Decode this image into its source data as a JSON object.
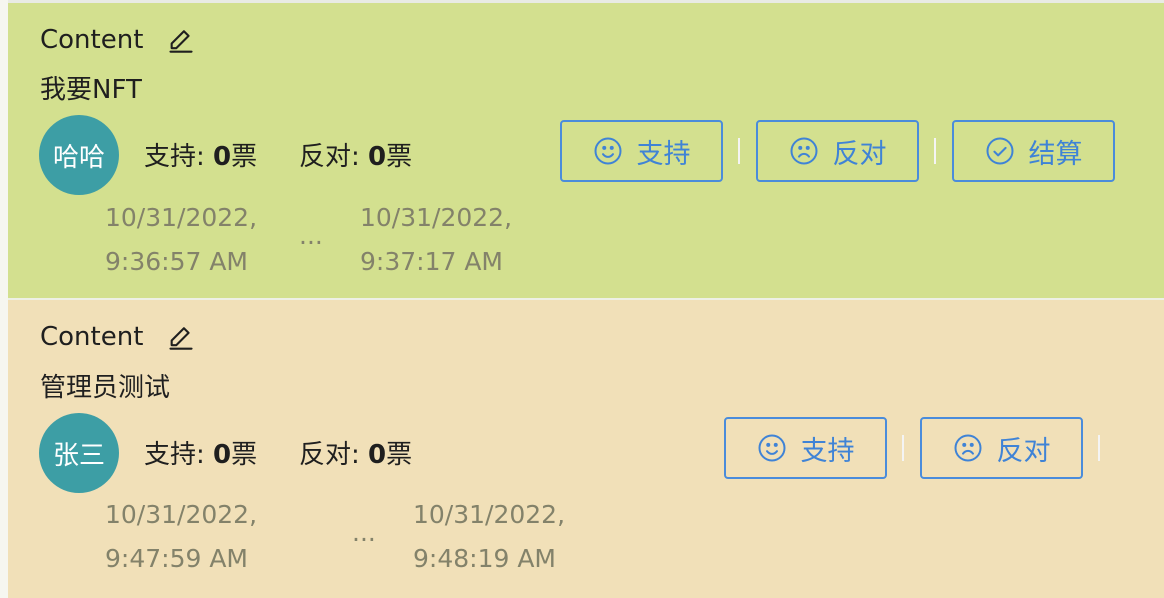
{
  "posts": [
    {
      "title": "Content",
      "content": "我要NFT",
      "avatar": "哈哈",
      "support_label": "支持: ",
      "support_count": "0",
      "oppose_label": "反对: ",
      "oppose_count": "0",
      "vote_unit": "票",
      "buttons": {
        "support": "支持",
        "oppose": "反对",
        "settle": "结算"
      },
      "start_date": "10/31/2022,",
      "start_time": "9:36:57 AM",
      "end_date": "10/31/2022,",
      "end_time": "9:37:17 AM",
      "ellipsis": "..."
    },
    {
      "title": "Content",
      "content": "管理员测试",
      "avatar": "张三",
      "support_label": "支持: ",
      "support_count": "0",
      "oppose_label": "反对: ",
      "oppose_count": "0",
      "vote_unit": "票",
      "buttons": {
        "support": "支持",
        "oppose": "反对"
      },
      "start_date": "10/31/2022,",
      "start_time": "9:47:59 AM",
      "end_date": "10/31/2022,",
      "end_time": "9:48:19 AM",
      "ellipsis": "..."
    }
  ],
  "colors": {
    "active_card": "#d3e08f",
    "pending_card": "#f1e0b8",
    "avatar": "#3d9ea5",
    "button": "#4a8cdb"
  },
  "icons": {
    "edit": "edit-icon",
    "smile": "smile-icon",
    "frown": "frown-icon",
    "check": "check-circle-icon"
  }
}
